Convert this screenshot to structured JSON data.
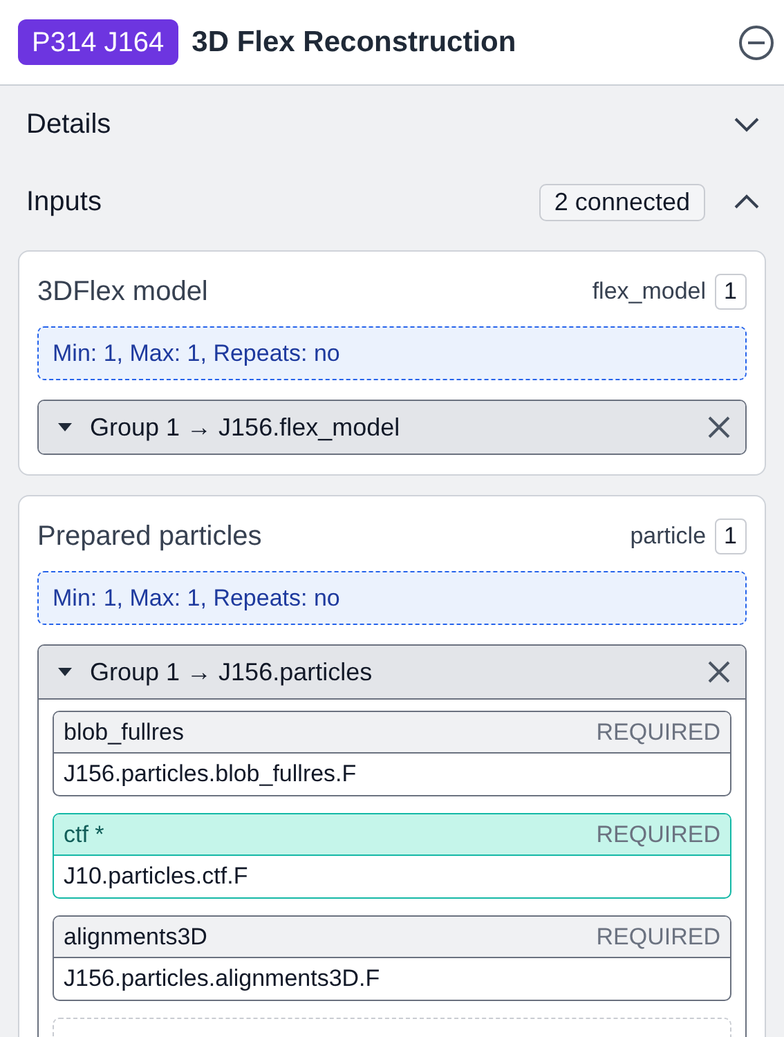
{
  "header": {
    "badge": "P314 J164",
    "title": "3D Flex Reconstruction"
  },
  "sections": [
    {
      "label": "Details",
      "expanded": false
    },
    {
      "label": "Inputs",
      "expanded": true,
      "count": "2 connected"
    }
  ],
  "inputs": [
    {
      "title": "3DFlex model",
      "type": "flex_model",
      "count": "1",
      "rule": "Min: 1, Max: 1, Repeats: no",
      "group": {
        "label": "Group 1 → J156.flex_model"
      }
    },
    {
      "title": "Prepared particles",
      "type": "particle",
      "count": "1",
      "rule": "Min: 1, Max: 1, Repeats: no",
      "group": {
        "label": "Group 1 → J156.particles",
        "slots": [
          {
            "name": "blob_fullres",
            "tag": "REQUIRED",
            "value": "J156.particles.blob_fullres.F",
            "highlighted": false
          },
          {
            "name": "ctf *",
            "tag": "REQUIRED",
            "value": "J10.particles.ctf.F",
            "highlighted": true
          },
          {
            "name": "alignments3D",
            "tag": "REQUIRED",
            "value": "J156.particles.alignments3D.F",
            "highlighted": false
          }
        ]
      }
    }
  ]
}
